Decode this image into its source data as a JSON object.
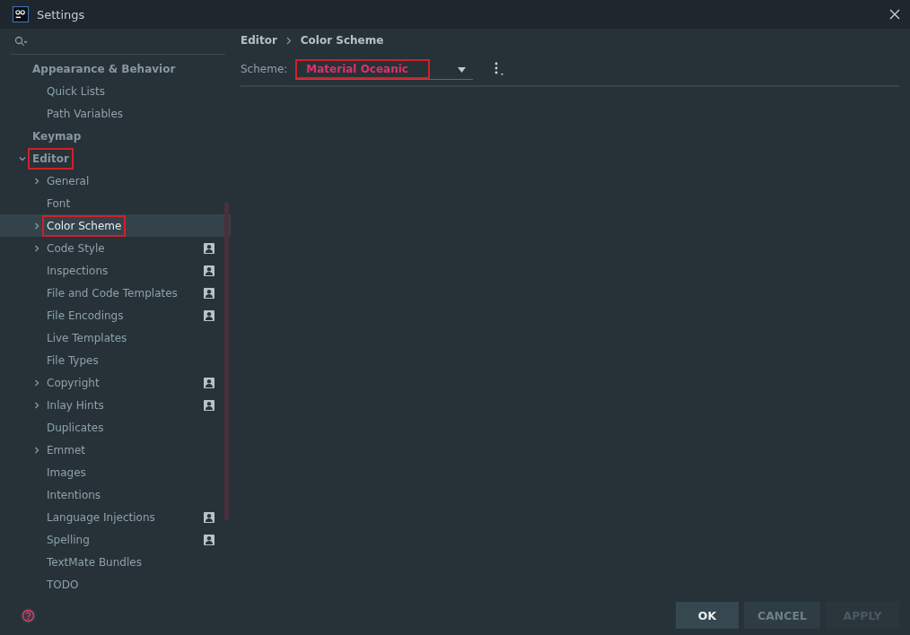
{
  "window": {
    "title": "Settings"
  },
  "sidebar": {
    "items": [
      {
        "label": "Appearance & Behavior",
        "kind": "leaf",
        "selected": false,
        "highlighted": false,
        "project_scoped": false,
        "children": [
          {
            "label": "Quick Lists",
            "kind": "leaf",
            "selected": false,
            "highlighted": false,
            "project_scoped": false
          },
          {
            "label": "Path Variables",
            "kind": "leaf",
            "selected": false,
            "highlighted": false,
            "project_scoped": false
          }
        ]
      },
      {
        "label": "Keymap",
        "kind": "leaf",
        "selected": false,
        "highlighted": false,
        "project_scoped": false
      },
      {
        "label": "Editor",
        "kind": "expanded",
        "selected": false,
        "highlighted": true,
        "project_scoped": false,
        "children": [
          {
            "label": "General",
            "kind": "collapsed",
            "selected": false,
            "highlighted": false,
            "project_scoped": false
          },
          {
            "label": "Font",
            "kind": "leaf",
            "selected": false,
            "highlighted": false,
            "project_scoped": false
          },
          {
            "label": "Color Scheme",
            "kind": "collapsed",
            "selected": true,
            "highlighted": true,
            "project_scoped": false
          },
          {
            "label": "Code Style",
            "kind": "collapsed",
            "selected": false,
            "highlighted": false,
            "project_scoped": true
          },
          {
            "label": "Inspections",
            "kind": "leaf",
            "selected": false,
            "highlighted": false,
            "project_scoped": true
          },
          {
            "label": "File and Code Templates",
            "kind": "leaf",
            "selected": false,
            "highlighted": false,
            "project_scoped": true
          },
          {
            "label": "File Encodings",
            "kind": "leaf",
            "selected": false,
            "highlighted": false,
            "project_scoped": true
          },
          {
            "label": "Live Templates",
            "kind": "leaf",
            "selected": false,
            "highlighted": false,
            "project_scoped": false
          },
          {
            "label": "File Types",
            "kind": "leaf",
            "selected": false,
            "highlighted": false,
            "project_scoped": false
          },
          {
            "label": "Copyright",
            "kind": "collapsed",
            "selected": false,
            "highlighted": false,
            "project_scoped": true
          },
          {
            "label": "Inlay Hints",
            "kind": "collapsed",
            "selected": false,
            "highlighted": false,
            "project_scoped": true
          },
          {
            "label": "Duplicates",
            "kind": "leaf",
            "selected": false,
            "highlighted": false,
            "project_scoped": false
          },
          {
            "label": "Emmet",
            "kind": "collapsed",
            "selected": false,
            "highlighted": false,
            "project_scoped": false
          },
          {
            "label": "Images",
            "kind": "leaf",
            "selected": false,
            "highlighted": false,
            "project_scoped": false
          },
          {
            "label": "Intentions",
            "kind": "leaf",
            "selected": false,
            "highlighted": false,
            "project_scoped": false
          },
          {
            "label": "Language Injections",
            "kind": "leaf",
            "selected": false,
            "highlighted": false,
            "project_scoped": true
          },
          {
            "label": "Spelling",
            "kind": "leaf",
            "selected": false,
            "highlighted": false,
            "project_scoped": true
          },
          {
            "label": "TextMate Bundles",
            "kind": "leaf",
            "selected": false,
            "highlighted": false,
            "project_scoped": false
          },
          {
            "label": "TODO",
            "kind": "leaf",
            "selected": false,
            "highlighted": false,
            "project_scoped": false
          }
        ]
      }
    ]
  },
  "breadcrumb": [
    "Editor",
    "Color Scheme"
  ],
  "scheme": {
    "label": "Scheme:",
    "value": "Material Oceanic",
    "highlighted": true
  },
  "buttons": [
    {
      "label": "OK",
      "kind": "primary",
      "disabled": false
    },
    {
      "label": "CANCEL",
      "kind": "normal",
      "disabled": false
    },
    {
      "label": "APPLY",
      "kind": "normal",
      "disabled": true
    }
  ]
}
